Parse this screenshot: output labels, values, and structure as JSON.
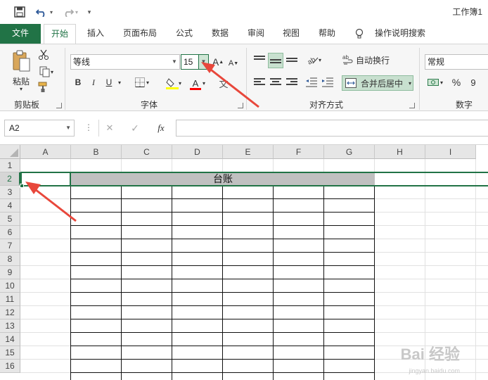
{
  "titlebar": {
    "title": "工作簿1",
    "undo_icon": "undo-icon",
    "redo_icon": "redo-icon",
    "save_icon": "save-icon"
  },
  "tabs": [
    {
      "label": "文件"
    },
    {
      "label": "开始"
    },
    {
      "label": "插入"
    },
    {
      "label": "页面布局"
    },
    {
      "label": "公式"
    },
    {
      "label": "数据"
    },
    {
      "label": "审阅"
    },
    {
      "label": "视图"
    },
    {
      "label": "帮助"
    },
    {
      "label": "操作说明搜索"
    }
  ],
  "ribbon": {
    "clipboard": {
      "paste_label": "粘贴",
      "group_label": "剪贴板"
    },
    "font": {
      "font_name": "等线",
      "font_size": "15",
      "group_label": "字体",
      "bold": "B",
      "italic": "I",
      "underline": "U",
      "grow": "A",
      "shrink": "A",
      "font_color_letter": "A"
    },
    "alignment": {
      "wrap_label": "自动换行",
      "merge_label": "合并后居中",
      "group_label": "对齐方式"
    },
    "number": {
      "format": "常规",
      "percent": "%",
      "comma": "9",
      "group_label": "数字"
    },
    "colors": {
      "accent": "#217346",
      "arrow": "#e8473b",
      "highlight_yellow": "#ffff00",
      "font_red": "#ff0000"
    }
  },
  "formula_bar": {
    "name_box": "A2",
    "fx_label": "fx",
    "cancel": "✕",
    "confirm": "✓",
    "value": ""
  },
  "grid": {
    "columns": [
      "A",
      "B",
      "C",
      "D",
      "E",
      "F",
      "G",
      "H",
      "I"
    ],
    "rows": [
      "1",
      "2",
      "3",
      "4",
      "5",
      "6",
      "7",
      "8",
      "9",
      "10",
      "11",
      "12",
      "13",
      "14",
      "15",
      "16"
    ],
    "merged_cell_text": "台账"
  },
  "watermark": {
    "text": "Bai 经验",
    "sub": "jingyan.baidu.com"
  }
}
